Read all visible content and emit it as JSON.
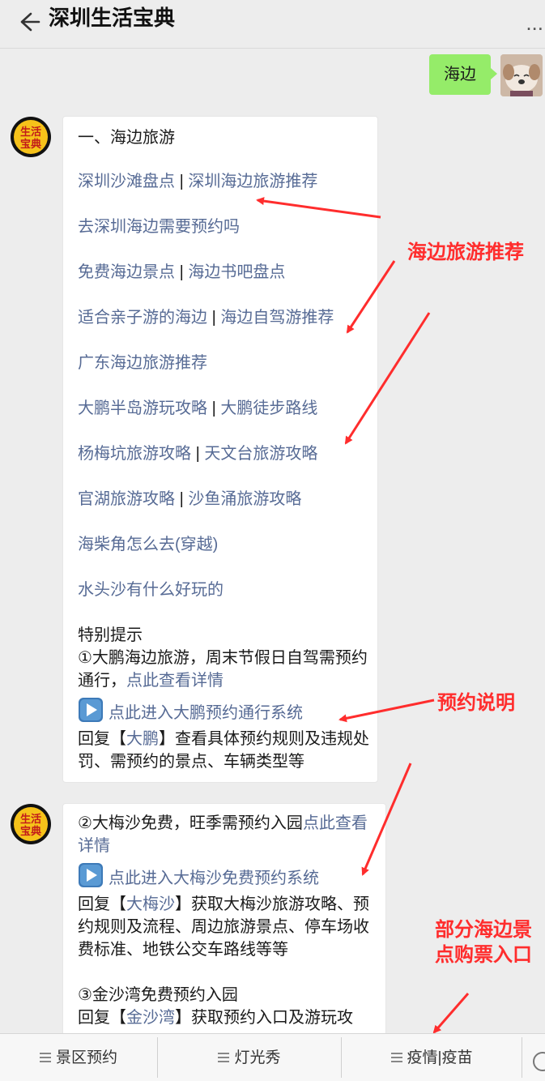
{
  "header": {
    "title": "深圳生活宝典",
    "more": "..."
  },
  "self_message": {
    "text": "海边"
  },
  "bot": {
    "avatar_text": "生活宝典"
  },
  "bubble1": {
    "heading": "一、海边旅游",
    "links": [
      {
        "a": "深圳沙滩盘点",
        "b": "深圳海边旅游推荐"
      },
      {
        "a": "去深圳海边需要预约吗"
      },
      {
        "a": "免费海边景点",
        "b": "海边书吧盘点"
      },
      {
        "a": "适合亲子游的海边",
        "b": "海边自驾游推荐"
      },
      {
        "a": "广东海边旅游推荐"
      },
      {
        "a": "大鹏半岛游玩攻略",
        "b": "大鹏徒步路线"
      },
      {
        "a": "杨梅坑旅游攻略",
        "b": "天文台旅游攻略"
      },
      {
        "a": "官湖旅游攻略",
        "b": "沙鱼涌旅游攻略"
      },
      {
        "a": "海柴角怎么去(穿越)"
      },
      {
        "a": "水头沙有什么好玩的"
      }
    ],
    "separator": "|",
    "tip_title": "特别提示",
    "tip_text": "①大鹏海边旅游，周末节假日自驾需预约通行，",
    "tip_link": "点此查看详情",
    "entry_link": "点此进入大鹏预约通行系统",
    "reply_prefix": "回复【",
    "reply_keyword": "大鹏",
    "reply_suffix": "】查看具体预约规则及违规处罚、需预约的景点、车辆类型等"
  },
  "bubble2": {
    "p1_text": "②大梅沙免费，旺季需预约入园",
    "p1_link": "点此查看详情",
    "entry_link": "点此进入大梅沙免费预约系统",
    "reply_prefix": "回复【",
    "reply_keyword": "大梅沙",
    "reply_suffix": "】获取大梅沙旅游攻略、预约规则及流程、周边旅游景点、停车场收费标准、地铁公交车路线等等",
    "p3_text": "③金沙湾免费预约入园",
    "p3_reply_prefix": "回复【",
    "p3_reply_keyword": "金沙湾",
    "p3_reply_suffix": "】获取预约入口及游玩攻"
  },
  "annotations": {
    "a1": "海边旅游推荐",
    "a2": "预约说明",
    "a3_line1": "部分海边景",
    "a3_line2": "点购票入口"
  },
  "menu": [
    {
      "label": "景区预约"
    },
    {
      "label": "灯光秀"
    },
    {
      "label": "疫情|疫苗"
    }
  ],
  "colors": {
    "link": "#576b95",
    "self_bubble": "#95ec69",
    "annotation": "#ff2d2d"
  }
}
